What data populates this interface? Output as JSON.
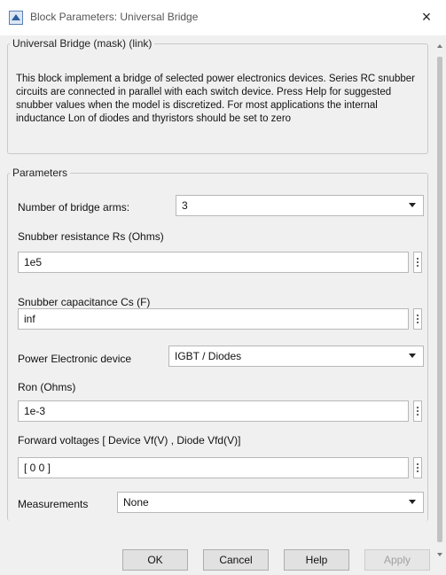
{
  "window": {
    "title": "Block Parameters: Universal Bridge",
    "close_glyph": "×"
  },
  "description": {
    "group_title": "Universal Bridge (mask) (link)",
    "text": "This block implement a bridge of selected power electronics devices.  Series RC snubber circuits are connected in parallel with each switch device.  Press Help for suggested snubber values when the model is discretized. For most applications the internal inductance Lon of diodes and thyristors should be set to zero"
  },
  "parameters": {
    "group_title": "Parameters",
    "bridge_arms": {
      "label": "Number of bridge arms:",
      "value": "3"
    },
    "snubber_resistance": {
      "label": "Snubber resistance Rs (Ohms)",
      "value": "1e5"
    },
    "snubber_capacitance": {
      "label": "Snubber capacitance Cs (F)",
      "value": "inf"
    },
    "power_device": {
      "label": "Power Electronic device",
      "value": "IGBT / Diodes"
    },
    "ron": {
      "label": "Ron (Ohms)",
      "value": "1e-3"
    },
    "forward_voltages": {
      "label": "Forward voltages  [ Device Vf(V) , Diode Vfd(V)]",
      "value": "[ 0 0 ]"
    },
    "measurements": {
      "label": "Measurements",
      "value": "None"
    }
  },
  "buttons": {
    "ok": "OK",
    "cancel": "Cancel",
    "help": "Help",
    "apply": "Apply"
  }
}
